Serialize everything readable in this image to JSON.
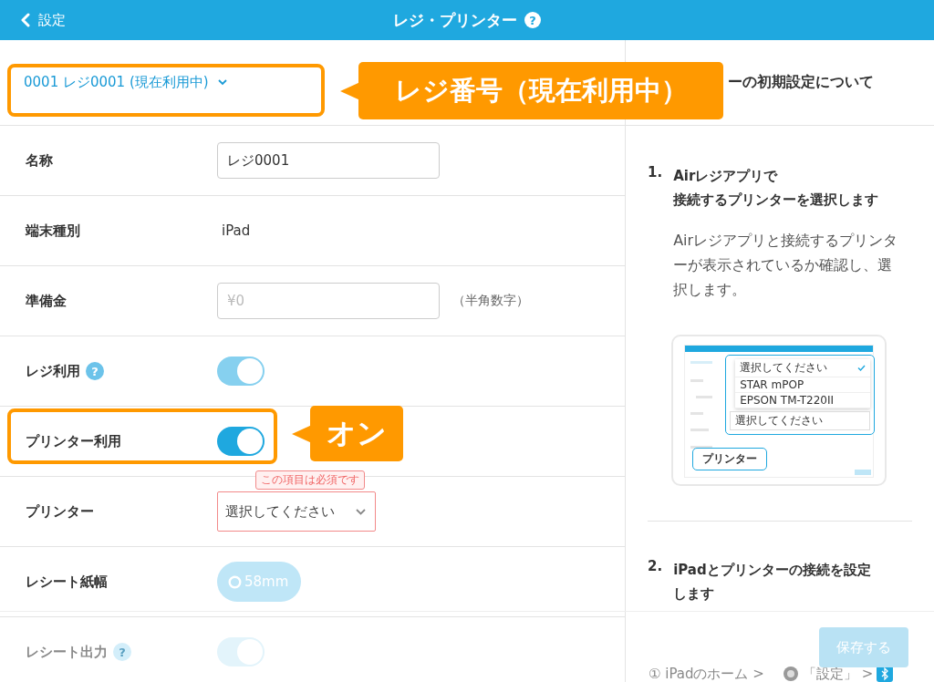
{
  "header": {
    "back_label": "設定",
    "title": "レジ・プリンター",
    "help_mark": "?"
  },
  "register_select": {
    "value": "0001 レジ0001 (現在利用中)"
  },
  "fields": [
    {
      "kind": "input",
      "label": "名称",
      "value": "レジ0001"
    },
    {
      "kind": "text",
      "label": "端末種別",
      "value": "iPad"
    },
    {
      "kind": "input",
      "label": "準備金",
      "placeholder": "¥0",
      "note": "（半角数字）"
    },
    {
      "kind": "toggle",
      "label": "レジ利用",
      "help": "?",
      "on": true,
      "disabled": true
    },
    {
      "kind": "toggle",
      "label": "プリンター利用",
      "on": true,
      "disabled": false
    },
    {
      "kind": "select",
      "label": "プリンター",
      "value": "選択してください",
      "error": "この項目は必須です"
    },
    {
      "kind": "option",
      "label": "レシート紙幅",
      "value": "58mm",
      "selected": false
    },
    {
      "kind": "toggle",
      "label": "レシート出力",
      "help": "?",
      "on": true,
      "disabled": true
    }
  ],
  "callouts": [
    {
      "text": "レジ番号（現在利用中）"
    },
    {
      "text": "オン"
    }
  ],
  "guide": {
    "heading": "ーの初期設定について",
    "steps": [
      {
        "number": "1.",
        "title_lines": [
          "Airレジアプリで",
          "接続するプリンターを選択します"
        ],
        "body": "Airレジアプリと接続するプリンターが表示されているか確認し、選択します。",
        "illustration": {
          "menu_options": [
            {
              "label": "選択してください",
              "selected": true
            },
            {
              "label": "STAR mPOP",
              "selected": false
            },
            {
              "label": "EPSON TM-T220II",
              "selected": false
            }
          ],
          "select_value": "選択してください",
          "callout": "プリンター"
        }
      },
      {
        "number": "2.",
        "title_lines": [
          "iPadとプリンターの接続を設定します"
        ]
      }
    ],
    "substep": {
      "number": "①",
      "text": "iPadのホーム >",
      "settings_label": "「設定」 >"
    }
  },
  "save_button": {
    "label": "保存する",
    "disabled": true
  }
}
